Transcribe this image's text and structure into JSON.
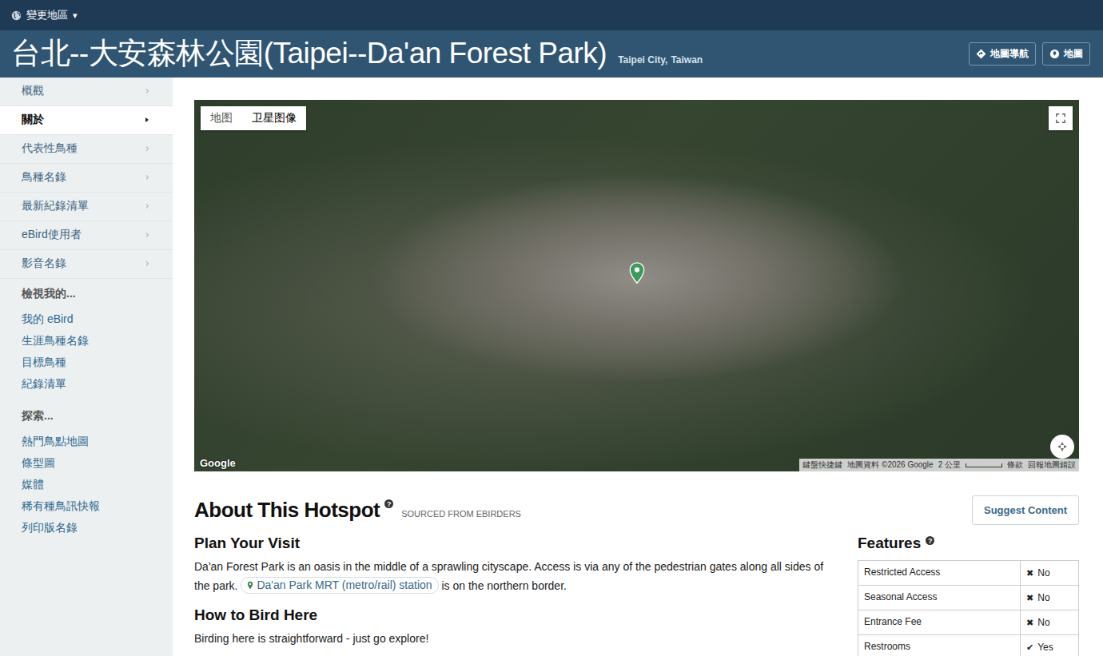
{
  "top_bar": {
    "label": "變更地區",
    "caret": "▾"
  },
  "header": {
    "title": "台北--大安森林公園(Taipei--Da'an Forest Park)",
    "location": [
      "Taipei City",
      "Taiwan"
    ],
    "separator": ",",
    "buttons": [
      {
        "label": "地圖導航"
      },
      {
        "label": "地圖"
      }
    ]
  },
  "sidebar": {
    "nav": [
      {
        "label": "概觀",
        "selected": false
      },
      {
        "label": "關於",
        "selected": true
      },
      {
        "label": "代表性鳥種",
        "selected": false
      },
      {
        "label": "鳥種名錄",
        "selected": false
      },
      {
        "label": "最新紀錄清單",
        "selected": false
      },
      {
        "label": "eBird使用者",
        "selected": false
      },
      {
        "label": "影音名錄",
        "selected": false
      }
    ],
    "sections": [
      {
        "title": "檢視我的...",
        "links": [
          "我的 eBird",
          "生涯鳥種名錄",
          "目標鳥種",
          "紀錄清單"
        ]
      },
      {
        "title": "探索...",
        "links": [
          "熱門鳥點地圖",
          "條型圖",
          "媒體",
          "稀有種鳥訊快報",
          "列印版名錄"
        ]
      }
    ]
  },
  "map": {
    "tabs": [
      {
        "label": "地图",
        "selected": false
      },
      {
        "label": "卫星图像",
        "selected": true
      }
    ],
    "logo": "Google",
    "attribution": [
      "鍵盤快捷鍵",
      "地圖資料 ©2026 Google",
      "2 公里",
      "條款",
      "回報地圖錯誤"
    ]
  },
  "about": {
    "title": "About This Hotspot",
    "help": "?",
    "source": "SOURCED FROM EBIRDERS",
    "suggest_button": "Suggest Content",
    "sections": [
      {
        "heading": "Plan Your Visit",
        "parts": [
          {
            "kind": "text",
            "text": "Da'an Forest Park is an oasis in the middle of a sprawling cityscape. Access is via any of the pedestrian gates along all sides of the park. "
          },
          {
            "kind": "link",
            "text": "Da'an Park MRT (metro/rail) station"
          },
          {
            "kind": "text",
            "text": " is on the northern border."
          }
        ]
      },
      {
        "heading": "How to Bird Here",
        "parts": [
          {
            "kind": "text",
            "text": "Birding here is straightforward - just go explore!"
          }
        ]
      }
    ]
  },
  "features": {
    "title": "Features",
    "help": "?",
    "rows": [
      {
        "label": "Restricted Access",
        "mark": "✖",
        "value": "No"
      },
      {
        "label": "Seasonal Access",
        "mark": "✖",
        "value": "No"
      },
      {
        "label": "Entrance Fee",
        "mark": "✖",
        "value": "No"
      },
      {
        "label": "Restrooms",
        "mark": "✔",
        "value": "Yes"
      }
    ]
  }
}
